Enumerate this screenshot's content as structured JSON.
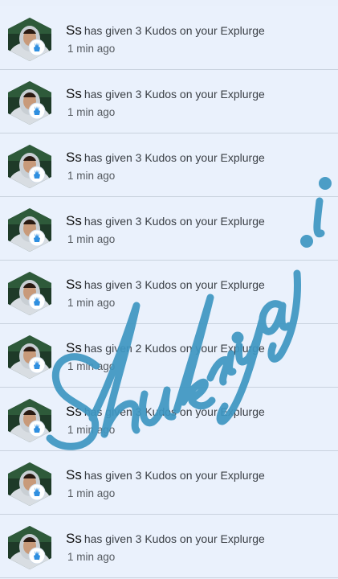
{
  "notifications": [
    {
      "user": "Ss",
      "message": "has given 3 Kudos on your Explurge",
      "time": "1 min ago"
    },
    {
      "user": "Ss",
      "message": "has given 3 Kudos on your Explurge",
      "time": "1 min ago"
    },
    {
      "user": "Ss",
      "message": "has given 3 Kudos on your Explurge",
      "time": "1 min ago"
    },
    {
      "user": "Ss",
      "message": "has given 3 Kudos on your Explurge",
      "time": "1 min ago"
    },
    {
      "user": "Ss",
      "message": "has given 3 Kudos on your Explurge",
      "time": "1 min ago"
    },
    {
      "user": "Ss",
      "message": "has given 2 Kudos on your Explurge",
      "time": "1 min ago"
    },
    {
      "user": "Ss",
      "message": "has given 3 Kudos on your Explurge",
      "time": "1 min ago"
    },
    {
      "user": "Ss",
      "message": "has given 3 Kudos on your Explurge",
      "time": "1 min ago"
    },
    {
      "user": "Ss",
      "message": "has given 3 Kudos on your Explurge",
      "time": "1 min ago"
    }
  ],
  "watermark_text": "Shukriya ji",
  "colors": {
    "background": "#eaf1fc",
    "divider": "#c9d2de",
    "kudos_badge": "#2f8fe0",
    "watermark": "#3f97c2"
  },
  "icons": {
    "badge": "kudos-hand-icon",
    "avatar": "user-avatar"
  }
}
